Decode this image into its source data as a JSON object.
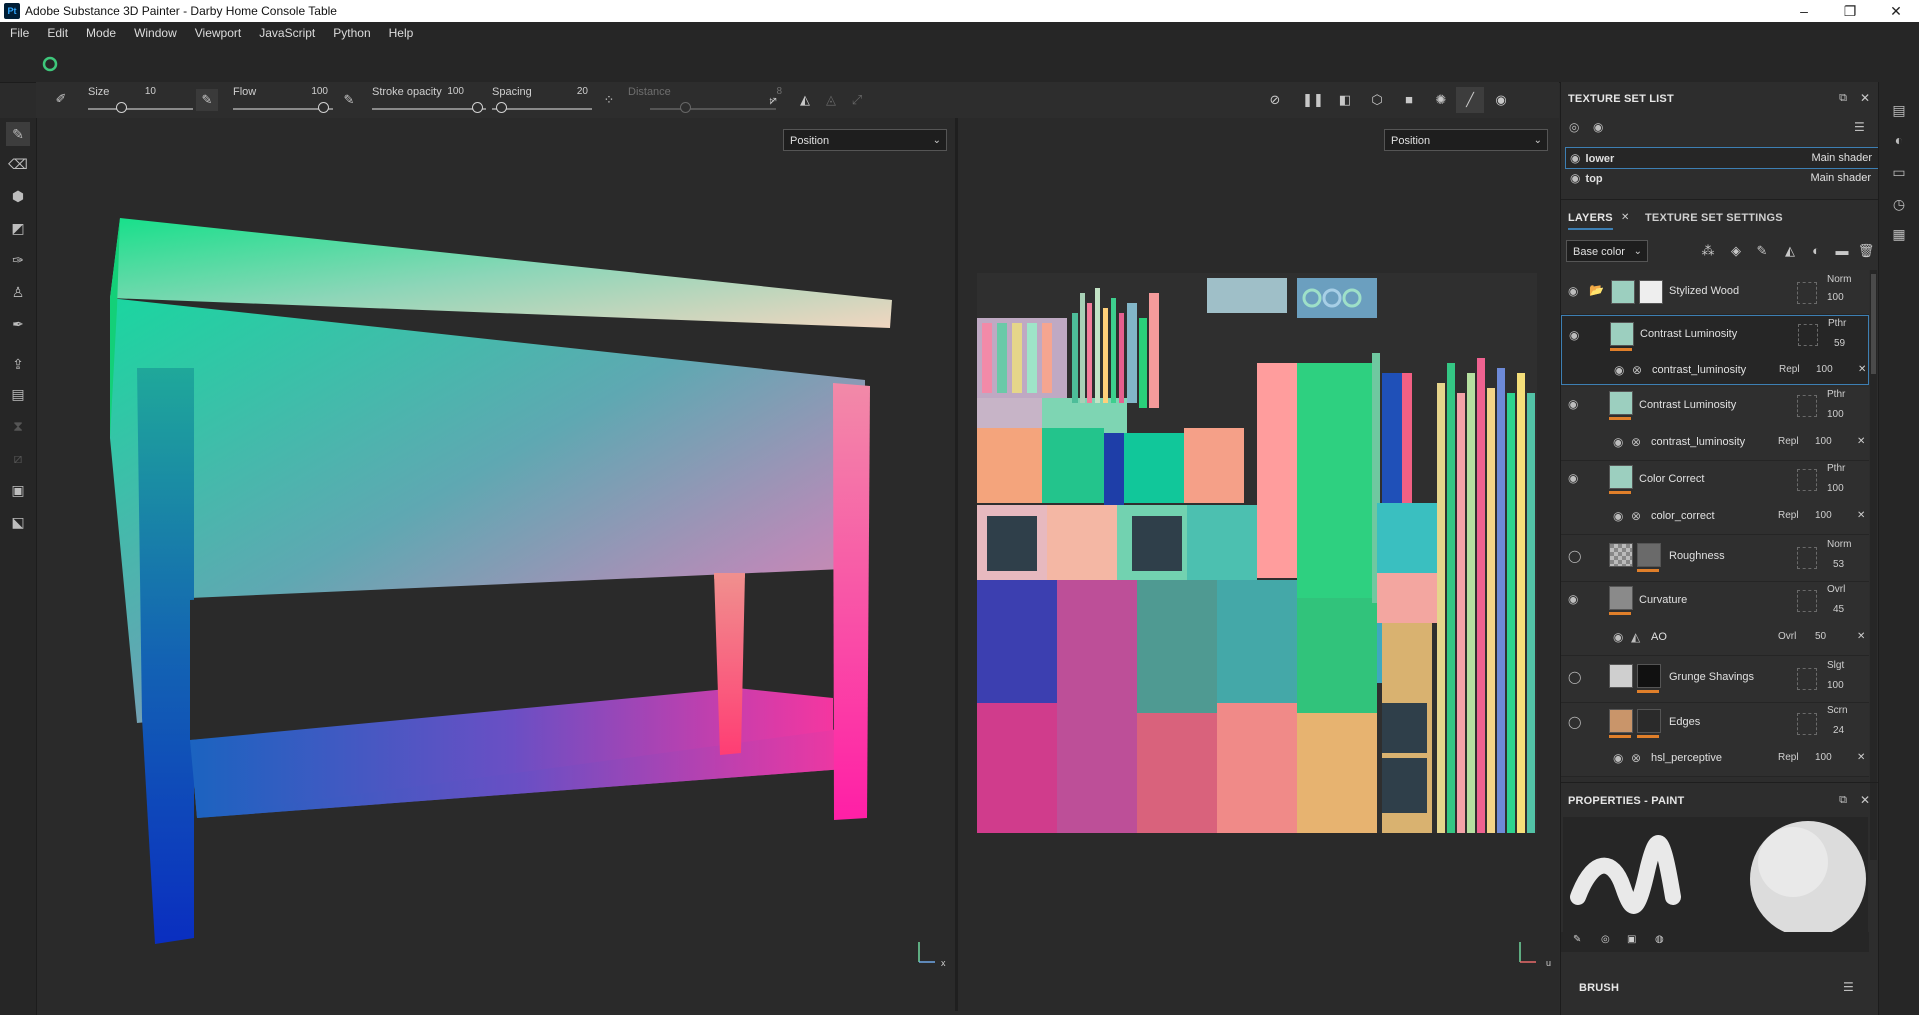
{
  "window": {
    "app_icon": "Pt",
    "title": "Adobe Substance 3D Painter - Darby Home Console Table",
    "controls": [
      "–",
      "❐",
      "✕"
    ]
  },
  "menu": [
    "File",
    "Edit",
    "Mode",
    "Window",
    "Viewport",
    "JavaScript",
    "Python",
    "Help"
  ],
  "tool_options": {
    "size_label": "Size",
    "size_value": "10",
    "flow_label": "Flow",
    "flow_value": "100",
    "stroke_opacity_label": "Stroke opacity",
    "stroke_opacity_value": "100",
    "spacing_label": "Spacing",
    "spacing_value": "20",
    "distance_label": "Distance",
    "distance_value": "8"
  },
  "viewport3d": {
    "channel": "Position",
    "axis_x": "x"
  },
  "viewport2d": {
    "channel": "Position",
    "axis_u": "u"
  },
  "texture_set_list": {
    "title": "TEXTURE SET LIST",
    "sets": [
      {
        "name": "lower",
        "shader": "Main shader"
      },
      {
        "name": "top",
        "shader": "Main shader"
      }
    ]
  },
  "layers_panel": {
    "tab_layers": "LAYERS",
    "tab_settings": "TEXTURE SET SETTINGS",
    "channel": "Base color",
    "rows": [
      {
        "name": "Stylized Wood",
        "blend": "Norm",
        "opacity": "100",
        "kind": "folder"
      },
      {
        "name": "Contrast Luminosity",
        "blend": "Pthr",
        "opacity": "59",
        "kind": "fill",
        "selected": true,
        "effect": {
          "name": "contrast_luminosity",
          "blend": "Repl",
          "opacity": "100"
        }
      },
      {
        "name": "Contrast Luminosity",
        "blend": "Pthr",
        "opacity": "100",
        "kind": "fill",
        "effect": {
          "name": "contrast_luminosity",
          "blend": "Repl",
          "opacity": "100"
        }
      },
      {
        "name": "Color Correct",
        "blend": "Pthr",
        "opacity": "100",
        "kind": "fill",
        "effect": {
          "name": "color_correct",
          "blend": "Repl",
          "opacity": "100"
        }
      },
      {
        "name": "Roughness",
        "blend": "Norm",
        "opacity": "53",
        "kind": "fill"
      },
      {
        "name": "Curvature",
        "blend": "Ovrl",
        "opacity": "45",
        "kind": "fill",
        "effect": {
          "name": "AO",
          "blend": "Ovrl",
          "opacity": "50"
        }
      },
      {
        "name": "Grunge Shavings",
        "blend": "Slgt",
        "opacity": "100",
        "kind": "fill"
      },
      {
        "name": "Edges",
        "blend": "Scrn",
        "opacity": "24",
        "kind": "fill",
        "effect": {
          "name": "hsl_perceptive",
          "blend": "Repl",
          "opacity": "100"
        }
      }
    ]
  },
  "properties": {
    "title": "PROPERTIES - PAINT",
    "brush_label": "BRUSH"
  },
  "colors": {
    "accent": "#e07f2a",
    "selection": "#3d7fb3",
    "panel": "#2d2d2d"
  }
}
